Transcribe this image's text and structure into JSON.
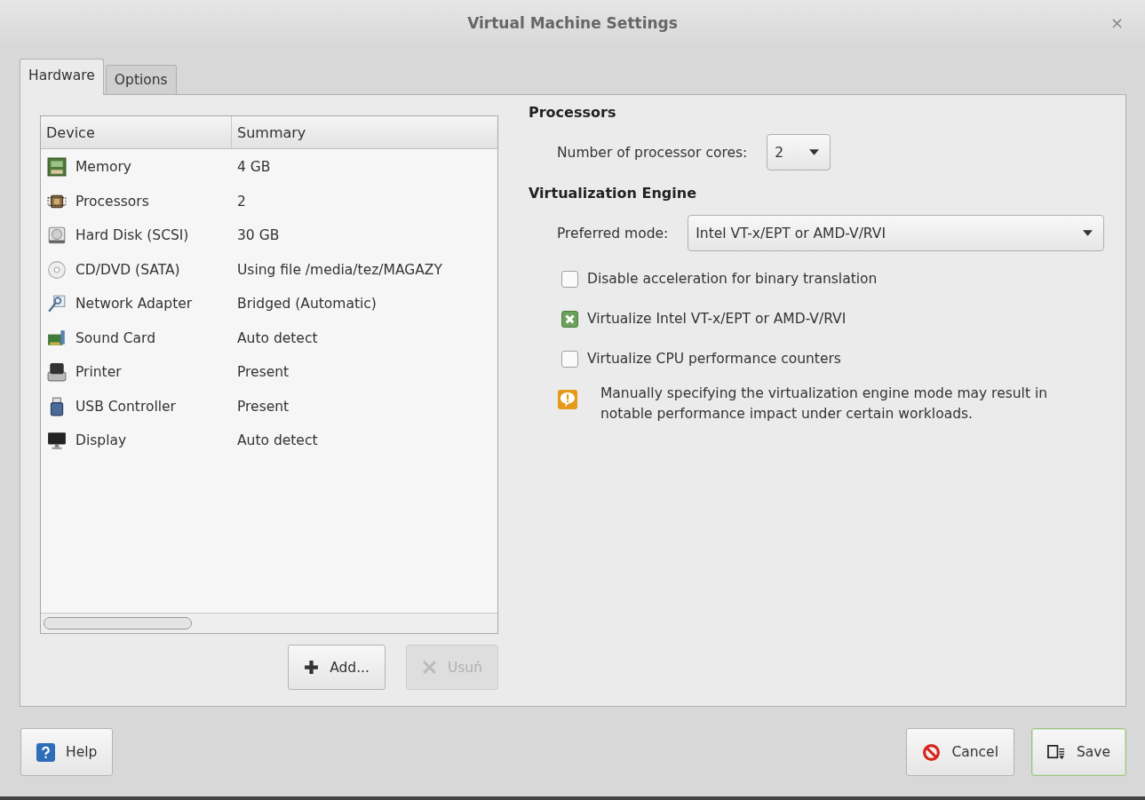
{
  "window": {
    "title": "Virtual Machine Settings",
    "close": "×"
  },
  "tabs": [
    {
      "label": "Hardware",
      "selected": true
    },
    {
      "label": "Options",
      "selected": false
    }
  ],
  "devices": {
    "columns": [
      "Device",
      "Summary"
    ],
    "rows": [
      {
        "kind": "memory",
        "device": "Memory",
        "summary": "4 GB"
      },
      {
        "kind": "processor",
        "device": "Processors",
        "summary": "2"
      },
      {
        "kind": "disk",
        "device": "Hard Disk (SCSI)",
        "summary": "30 GB"
      },
      {
        "kind": "cdrom",
        "device": "CD/DVD (SATA)",
        "summary": "Using file /media/tez/MAGAZY"
      },
      {
        "kind": "network",
        "device": "Network Adapter",
        "summary": "Bridged (Automatic)"
      },
      {
        "kind": "sound",
        "device": "Sound Card",
        "summary": "Auto detect"
      },
      {
        "kind": "printer",
        "device": "Printer",
        "summary": "Present"
      },
      {
        "kind": "usb",
        "device": "USB Controller",
        "summary": "Present"
      },
      {
        "kind": "display",
        "device": "Display",
        "summary": "Auto detect"
      }
    ],
    "buttons": [
      {
        "label": "Add...",
        "kind": "add",
        "disabled": false
      },
      {
        "label": "Usuń",
        "kind": "remove",
        "disabled": true
      }
    ]
  },
  "processors": {
    "heading": "Processors",
    "cores_label": "Number of processor cores:",
    "cores_value": "2"
  },
  "engine": {
    "heading": "Virtualization Engine",
    "mode_label": "Preferred mode:",
    "mode_value": "Intel VT-x/EPT or AMD-V/RVI",
    "options": [
      {
        "label": "Disable acceleration for binary translation",
        "checked": false
      },
      {
        "label": "Virtualize Intel VT-x/EPT or AMD-V/RVI",
        "checked": true
      },
      {
        "label": "Virtualize CPU performance counters",
        "checked": false
      }
    ],
    "warning": "Manually specifying the virtualization engine mode may result in notable performance impact under certain workloads."
  },
  "footer": {
    "help": "Help",
    "cancel": "Cancel",
    "save": "Save"
  }
}
